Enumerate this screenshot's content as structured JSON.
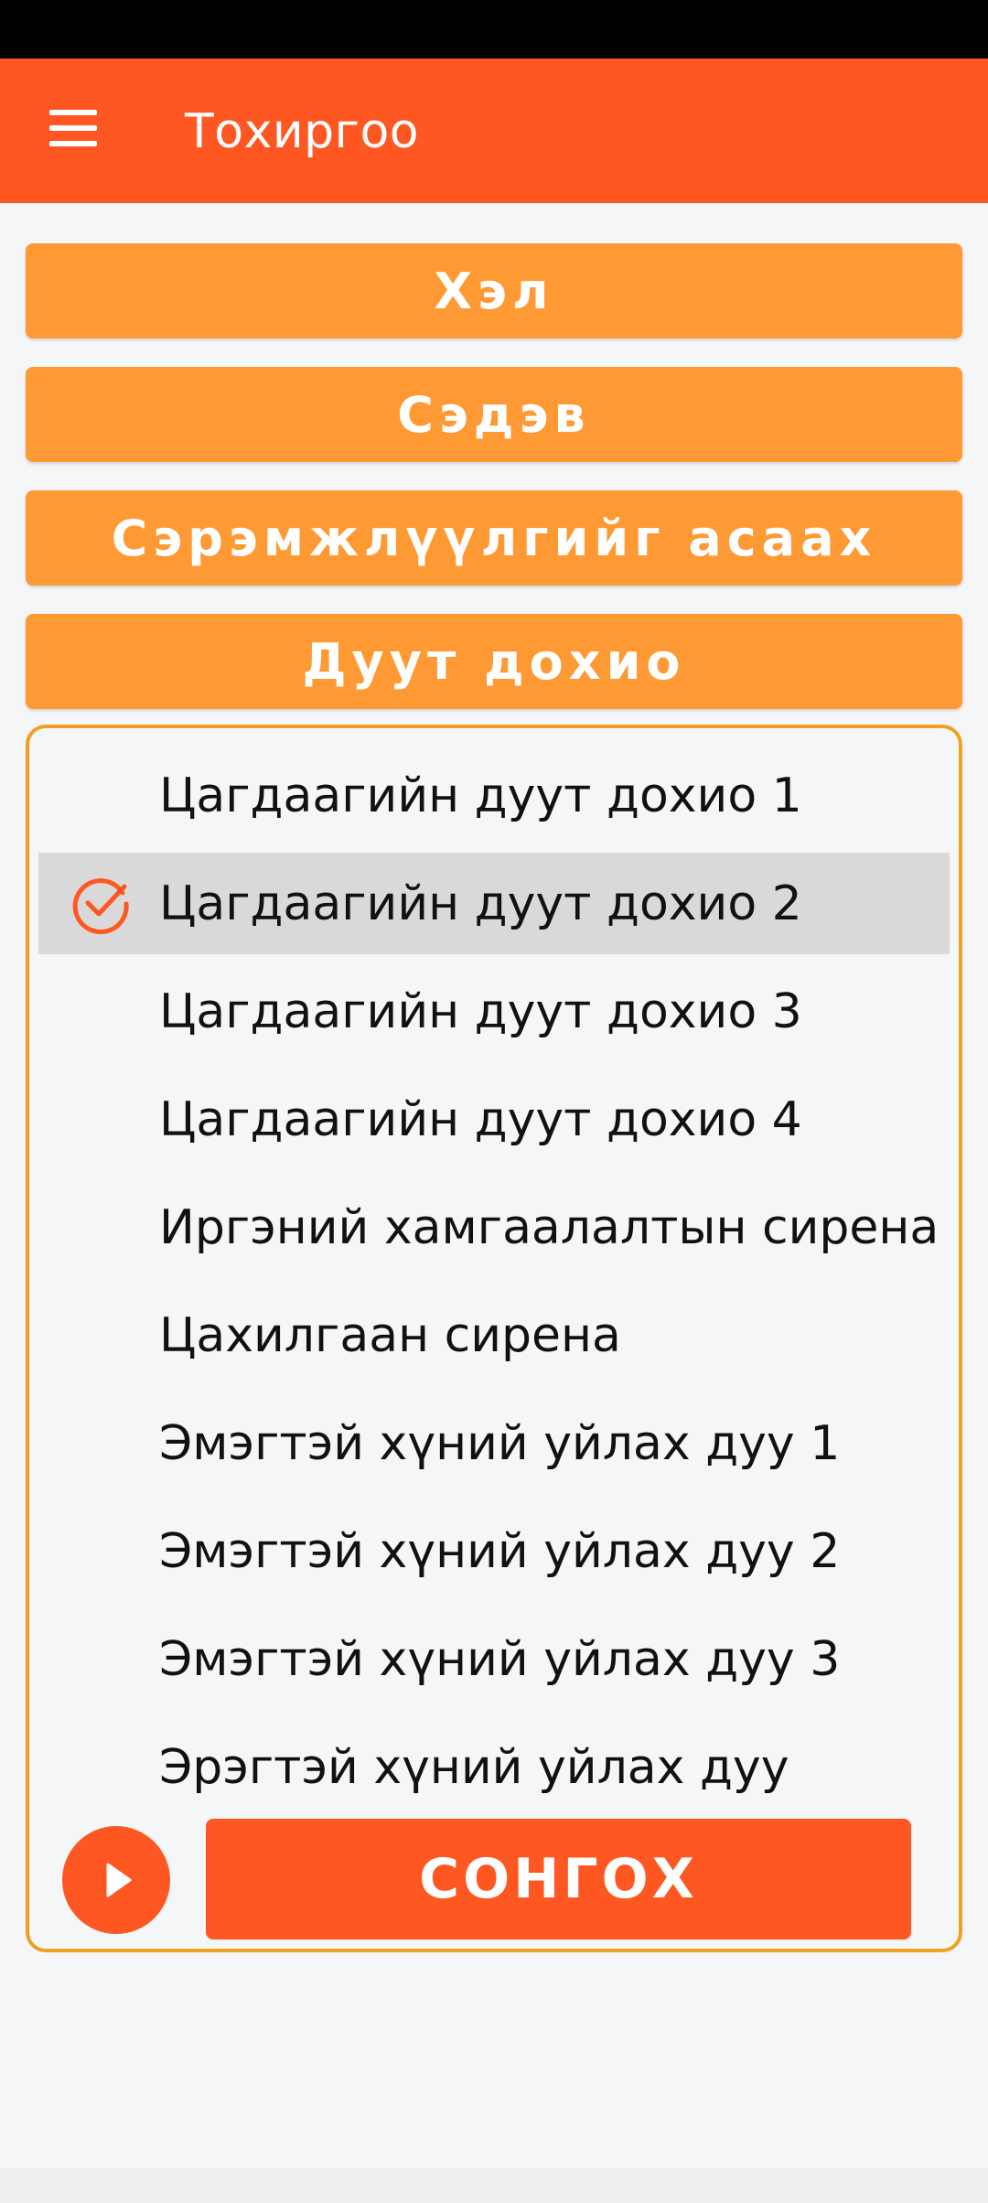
{
  "app_bar": {
    "title": "Тохиргоо",
    "menu_icon": "hamburger-menu-icon"
  },
  "settings": {
    "buttons": [
      {
        "label": "Хэл"
      },
      {
        "label": "Сэдэв"
      },
      {
        "label": "Сэрэмжлүүлгийг асаах"
      },
      {
        "label": "Дуут дохио"
      }
    ]
  },
  "sound_picker": {
    "selected_index": 1,
    "items": [
      {
        "label": "Цагдаагийн дуут дохио 1"
      },
      {
        "label": "Цагдаагийн дуут дохио 2"
      },
      {
        "label": "Цагдаагийн дуут дохио 3"
      },
      {
        "label": "Цагдаагийн дуут дохио 4"
      },
      {
        "label": "Иргэний хамгаалалтын сирена"
      },
      {
        "label": "Цахилгаан сирена"
      },
      {
        "label": "Эмэгтэй хүний уйлах дуу 1"
      },
      {
        "label": "Эмэгтэй хүний уйлах дуу 2"
      },
      {
        "label": "Эмэгтэй хүний уйлах дуу 3"
      },
      {
        "label": "Эрэгтэй хүний уйлах дуу"
      }
    ],
    "play_icon": "play-icon",
    "check_icon": "check-circle-icon",
    "select_label": "СОНГОХ"
  },
  "colors": {
    "primary": "#ff5722",
    "accent": "#ff9933",
    "panel_border": "#f0a020",
    "selected_row": "#d9d9d9"
  }
}
